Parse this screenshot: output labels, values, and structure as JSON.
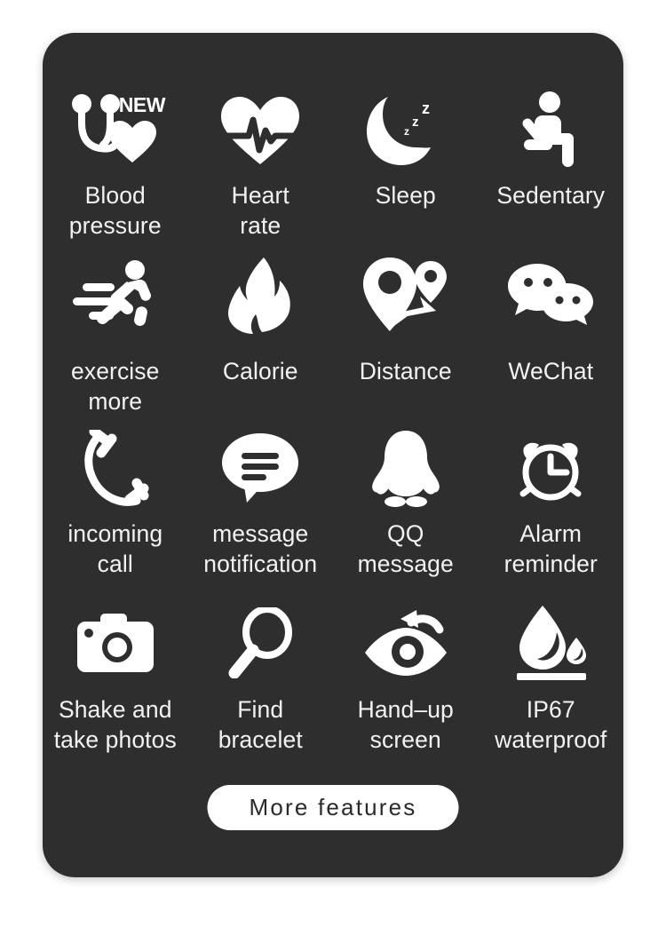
{
  "card": {
    "background_color": "#2e2e2e",
    "page_background_color": "#ffffff",
    "icon_color": "#ffffff",
    "label_color": "#f2f2f2"
  },
  "badges": {
    "new_label": "NEW"
  },
  "features": [
    {
      "icon": "stethoscope-heart-icon",
      "label": "Blood\npressure",
      "badge": "NEW"
    },
    {
      "icon": "heart-rate-icon",
      "label": "Heart\nrate"
    },
    {
      "icon": "moon-sleep-icon",
      "label": "Sleep"
    },
    {
      "icon": "seated-person-icon",
      "label": "Sedentary"
    },
    {
      "icon": "running-person-icon",
      "label": "exercise\nmore"
    },
    {
      "icon": "flame-icon",
      "label": "Calorie"
    },
    {
      "icon": "map-pin-route-icon",
      "label": "Distance"
    },
    {
      "icon": "wechat-bubbles-icon",
      "label": "WeChat"
    },
    {
      "icon": "phone-handset-icon",
      "label": "incoming\ncall"
    },
    {
      "icon": "speech-bubble-lines-icon",
      "label": "message\nnotification"
    },
    {
      "icon": "qq-penguin-icon",
      "label": "QQ\nmessage"
    },
    {
      "icon": "alarm-clock-icon",
      "label": "Alarm\nreminder"
    },
    {
      "icon": "camera-icon",
      "label": "Shake and\ntake photos"
    },
    {
      "icon": "magnifier-icon",
      "label": "Find\nbracelet"
    },
    {
      "icon": "eye-raise-arrow-icon",
      "label": "Hand–up\nscreen"
    },
    {
      "icon": "water-drop-icon",
      "label": "IP67\nwaterproof"
    }
  ],
  "more_button": {
    "label": "More features"
  }
}
